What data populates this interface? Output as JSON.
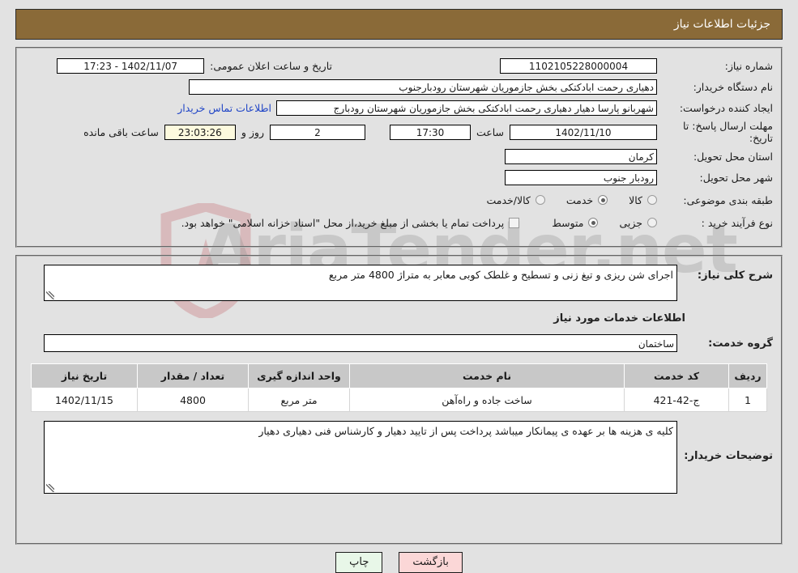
{
  "watermark": {
    "text": "AriaTender.net"
  },
  "header": {
    "title": "جزئیات اطلاعات نیاز"
  },
  "colors": {
    "header_bg": "#8a6a38",
    "page_bg": "#e2e2e2",
    "link": "#2146c7",
    "countdown_bg": "#fdfade",
    "table_header_bg": "#c8c8c8",
    "print_button_bg": "#e8f7e8",
    "back_button_bg": "#fbd7d7"
  },
  "form": {
    "need_number": {
      "label": "شماره نیاز:",
      "value": "1102105228000004"
    },
    "announce": {
      "label": "تاریخ و ساعت اعلان عمومی:",
      "value": "1402/11/07 - 17:23"
    },
    "buyer_org": {
      "label": "نام دستگاه خریدار:",
      "value": "دهیاری رحمت ابادکتکی بخش جازموریان شهرستان رودبارجنوب"
    },
    "creator": {
      "label": "ایجاد کننده درخواست:",
      "value": "شهربانو پارسا دهیار دهیاری رحمت ابادکتکی بخش جازموریان شهرستان رودبارج",
      "contact_link": "اطلاعات تماس خریدار"
    },
    "deadline": {
      "label": "مهلت ارسال پاسخ: تا تاریخ:",
      "date": "1402/11/10",
      "time_label": "ساعت",
      "time": "17:30",
      "days": "2",
      "days_label": "روز و",
      "remaining": "23:03:26",
      "remaining_label": "ساعت باقی مانده"
    },
    "province": {
      "label": "استان محل تحویل:",
      "value": "کرمان"
    },
    "city": {
      "label": "شهر محل تحویل:",
      "value": "رودبار جنوب"
    },
    "category": {
      "label": "طبقه بندی موضوعی:",
      "options": [
        {
          "label": "کالا",
          "selected": false
        },
        {
          "label": "خدمت",
          "selected": true
        },
        {
          "label": "کالا/خدمت",
          "selected": false
        }
      ]
    },
    "process_type": {
      "label": "نوع فرآیند خرید :",
      "options": [
        {
          "label": "جزیی",
          "selected": false
        },
        {
          "label": "متوسط",
          "selected": true
        }
      ],
      "checkbox_note": "پرداخت تمام یا بخشی از مبلغ خرید،از محل \"اسناد خزانه اسلامی\" خواهد بود.",
      "checkbox_checked": false
    }
  },
  "details": {
    "description": {
      "label": "شرح کلی نیاز:",
      "value": "اجرای شن ریزی و تیغ زنی و تسطیح و غلطک کوبی  معابر به متراژ 4800 متر مربع"
    },
    "services_section_title": "اطلاعات خدمات مورد نیاز",
    "service_group": {
      "label": "گروه خدمت:",
      "value": "ساختمان"
    },
    "table": {
      "columns": [
        "ردیف",
        "کد خدمت",
        "نام خدمت",
        "واحد اندازه گیری",
        "تعداد / مقدار",
        "تاریخ نیاز"
      ],
      "rows": [
        {
          "radif": "1",
          "code": "ج-42-421",
          "name": "ساخت جاده و راه‌آهن",
          "unit": "متر مربع",
          "qty": "4800",
          "date": "1402/11/15"
        }
      ]
    },
    "buyer_notes": {
      "label": "توضیحات خریدار:",
      "value": "کلیه ی هزینه ها بر عهده ی پیمانکار میباشد پرداخت پس از تایید دهیار و کارشناس فنی دهیاری دهیار"
    }
  },
  "buttons": {
    "print": "چاپ",
    "back": "بازگشت"
  }
}
